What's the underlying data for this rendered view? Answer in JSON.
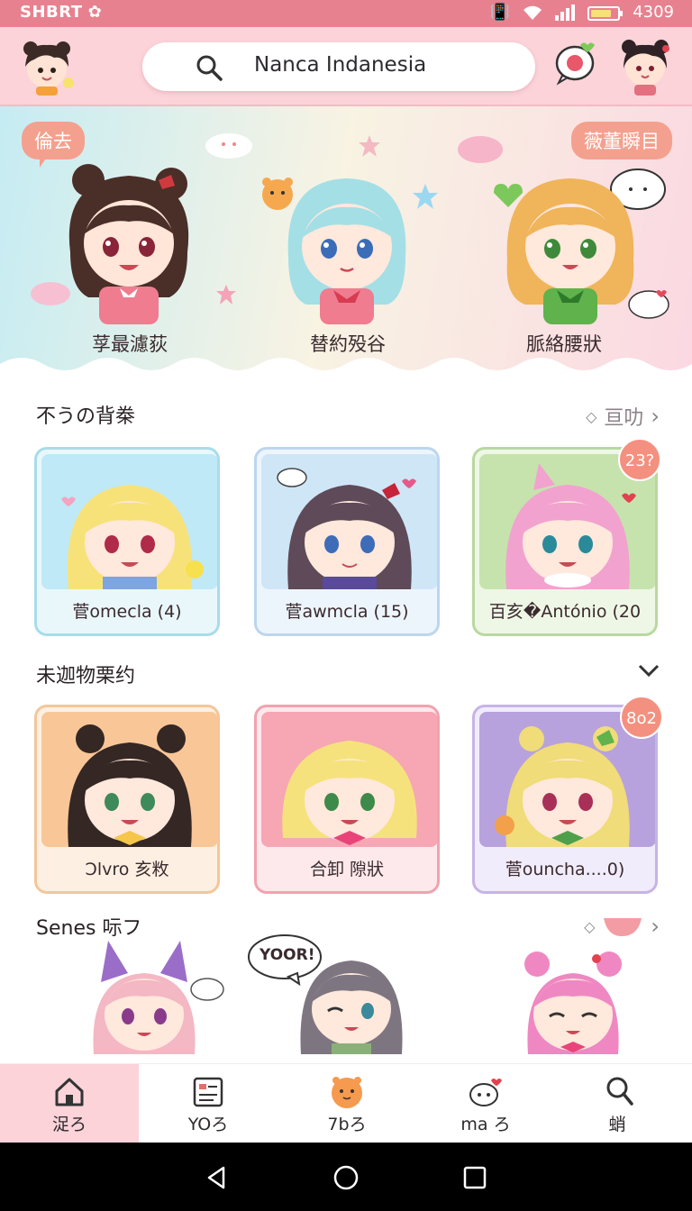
{
  "status_bar": {
    "carrier": "SHBRT",
    "time": "4309"
  },
  "search": {
    "query": "Nanca Indanesia"
  },
  "hero": {
    "left_badge": "倫去",
    "right_badge": "薇董瞬目",
    "characters": [
      {
        "name": "莩最濾荻"
      },
      {
        "name": "替約殁谷"
      },
      {
        "name": "脈絡腰狀"
      }
    ]
  },
  "section1": {
    "title": "不うの背桊",
    "more": "亘叻",
    "cards": [
      {
        "label": "菅omecla (4)"
      },
      {
        "label": "菅awmcla (15)"
      },
      {
        "label": "百亥�António (20",
        "badge": "23?"
      }
    ]
  },
  "section2": {
    "title": "未迦物栗约",
    "cards": [
      {
        "label": "Ɔlvro 亥敉"
      },
      {
        "label": "合卸 隙狀"
      },
      {
        "label": "菅ouncha....0)",
        "badge": "8o2"
      }
    ]
  },
  "section3": {
    "title": "Senes 呩フ",
    "speech": "YOOR!"
  },
  "bottom_nav": [
    {
      "label": "浞ろ",
      "icon": "home-icon"
    },
    {
      "label": "YOろ",
      "icon": "calendar-icon"
    },
    {
      "label": "7bろ",
      "icon": "mascot-icon"
    },
    {
      "label": "ma ろ",
      "icon": "chat-icon"
    },
    {
      "label": "蛸",
      "icon": "profile-icon"
    }
  ]
}
